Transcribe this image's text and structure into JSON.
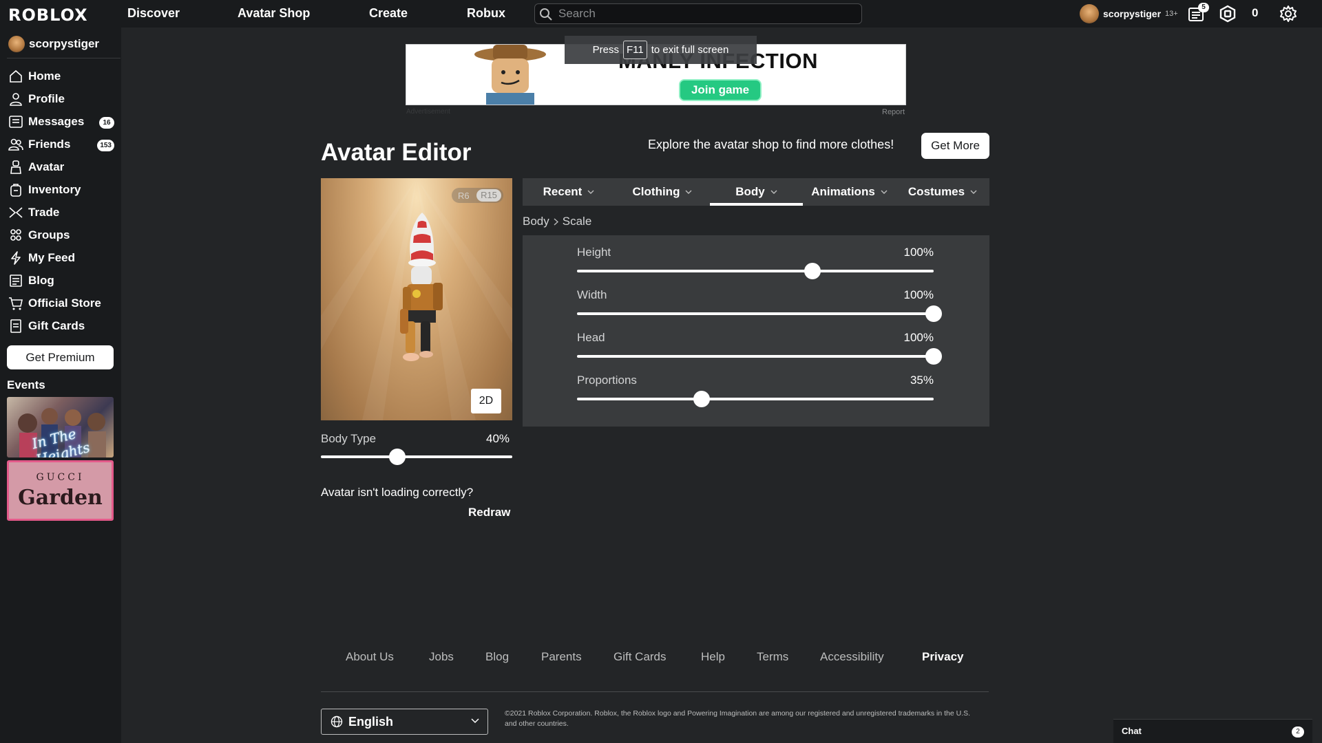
{
  "topnav": {
    "logo": "ROBLOX",
    "links": [
      "Discover",
      "Avatar Shop",
      "Create",
      "Robux"
    ],
    "search_placeholder": "Search",
    "username": "scorpystiger",
    "age_label": "13+",
    "notifications_count": "5",
    "robux_balance": "0"
  },
  "sidebar": {
    "username": "scorpystiger",
    "items": [
      {
        "label": "Home",
        "icon": "home-icon"
      },
      {
        "label": "Profile",
        "icon": "profile-icon"
      },
      {
        "label": "Messages",
        "icon": "messages-icon",
        "count": "16"
      },
      {
        "label": "Friends",
        "icon": "friends-icon",
        "count": "153"
      },
      {
        "label": "Avatar",
        "icon": "avatar-icon"
      },
      {
        "label": "Inventory",
        "icon": "inventory-icon"
      },
      {
        "label": "Trade",
        "icon": "trade-icon"
      },
      {
        "label": "Groups",
        "icon": "groups-icon"
      },
      {
        "label": "My Feed",
        "icon": "feed-icon"
      },
      {
        "label": "Blog",
        "icon": "blog-icon"
      },
      {
        "label": "Official Store",
        "icon": "store-icon"
      },
      {
        "label": "Gift Cards",
        "icon": "gift-cards-icon"
      }
    ],
    "premium_button": "Get Premium",
    "events_label": "Events",
    "events": [
      {
        "title": "In The Heights"
      },
      {
        "brand": "GUCCI",
        "title": "Garden"
      }
    ]
  },
  "ad": {
    "title": "MANLY INFECTION",
    "join_button": "Join game",
    "fullscreen_press": "Press",
    "fullscreen_key": "F11",
    "fullscreen_tail": "to exit full screen",
    "advertisement_label": "Advertisement",
    "report": "Report"
  },
  "editor": {
    "title": "Avatar Editor",
    "explore_text": "Explore the avatar shop to find more clothes!",
    "get_more_button": "Get More",
    "rig_options": [
      "R6",
      "R15"
    ],
    "rig_selected": "R15",
    "view_toggle": "2D",
    "body_type": {
      "label": "Body Type",
      "display": "40%",
      "value": 0.4
    },
    "loading_question": "Avatar isn't loading correctly?",
    "redraw": "Redraw",
    "tabs": [
      "Recent",
      "Clothing",
      "Body",
      "Animations",
      "Costumes"
    ],
    "active_tab": "Body",
    "breadcrumb": [
      "Body",
      "Scale"
    ],
    "scales": [
      {
        "label": "Height",
        "display": "100%",
        "value": 0.66
      },
      {
        "label": "Width",
        "display": "100%",
        "value": 1.0
      },
      {
        "label": "Head",
        "display": "100%",
        "value": 1.0
      },
      {
        "label": "Proportions",
        "display": "35%",
        "value": 0.35
      }
    ]
  },
  "footer": {
    "links": [
      "About Us",
      "Jobs",
      "Blog",
      "Parents",
      "Gift Cards",
      "Help",
      "Terms",
      "Accessibility",
      "Privacy"
    ],
    "language": "English",
    "copyright": "©2021 Roblox Corporation. Roblox, the Roblox logo and Powering Imagination are among our registered and unregistered trademarks in the U.S. and other countries."
  },
  "chat": {
    "label": "Chat",
    "count": "2"
  },
  "colors": {
    "background": "#232527",
    "panel": "#393b3d",
    "nav": "#191b1d",
    "accent_green": "#25c982"
  }
}
